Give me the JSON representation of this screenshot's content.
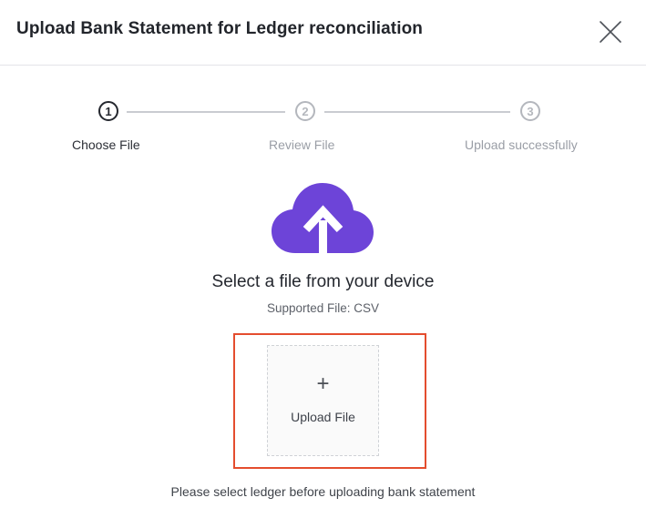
{
  "header": {
    "title": "Upload Bank Statement for Ledger reconciliation",
    "close_icon": "close-icon"
  },
  "stepper": {
    "steps": [
      {
        "number": "1",
        "label": "Choose File",
        "state": "active"
      },
      {
        "number": "2",
        "label": "Review File",
        "state": "inactive"
      },
      {
        "number": "3",
        "label": "Upload successfully",
        "state": "inactive"
      }
    ]
  },
  "upload": {
    "icon": "cloud-upload-icon",
    "icon_color": "#6d44d8",
    "title": "Select a file from your device",
    "supported": "Supported File: CSV",
    "tile_symbol": "+",
    "tile_label": "Upload File",
    "highlight_color": "#e44d2e"
  },
  "footer": {
    "note": "Please select ledger before uploading bank statement"
  }
}
